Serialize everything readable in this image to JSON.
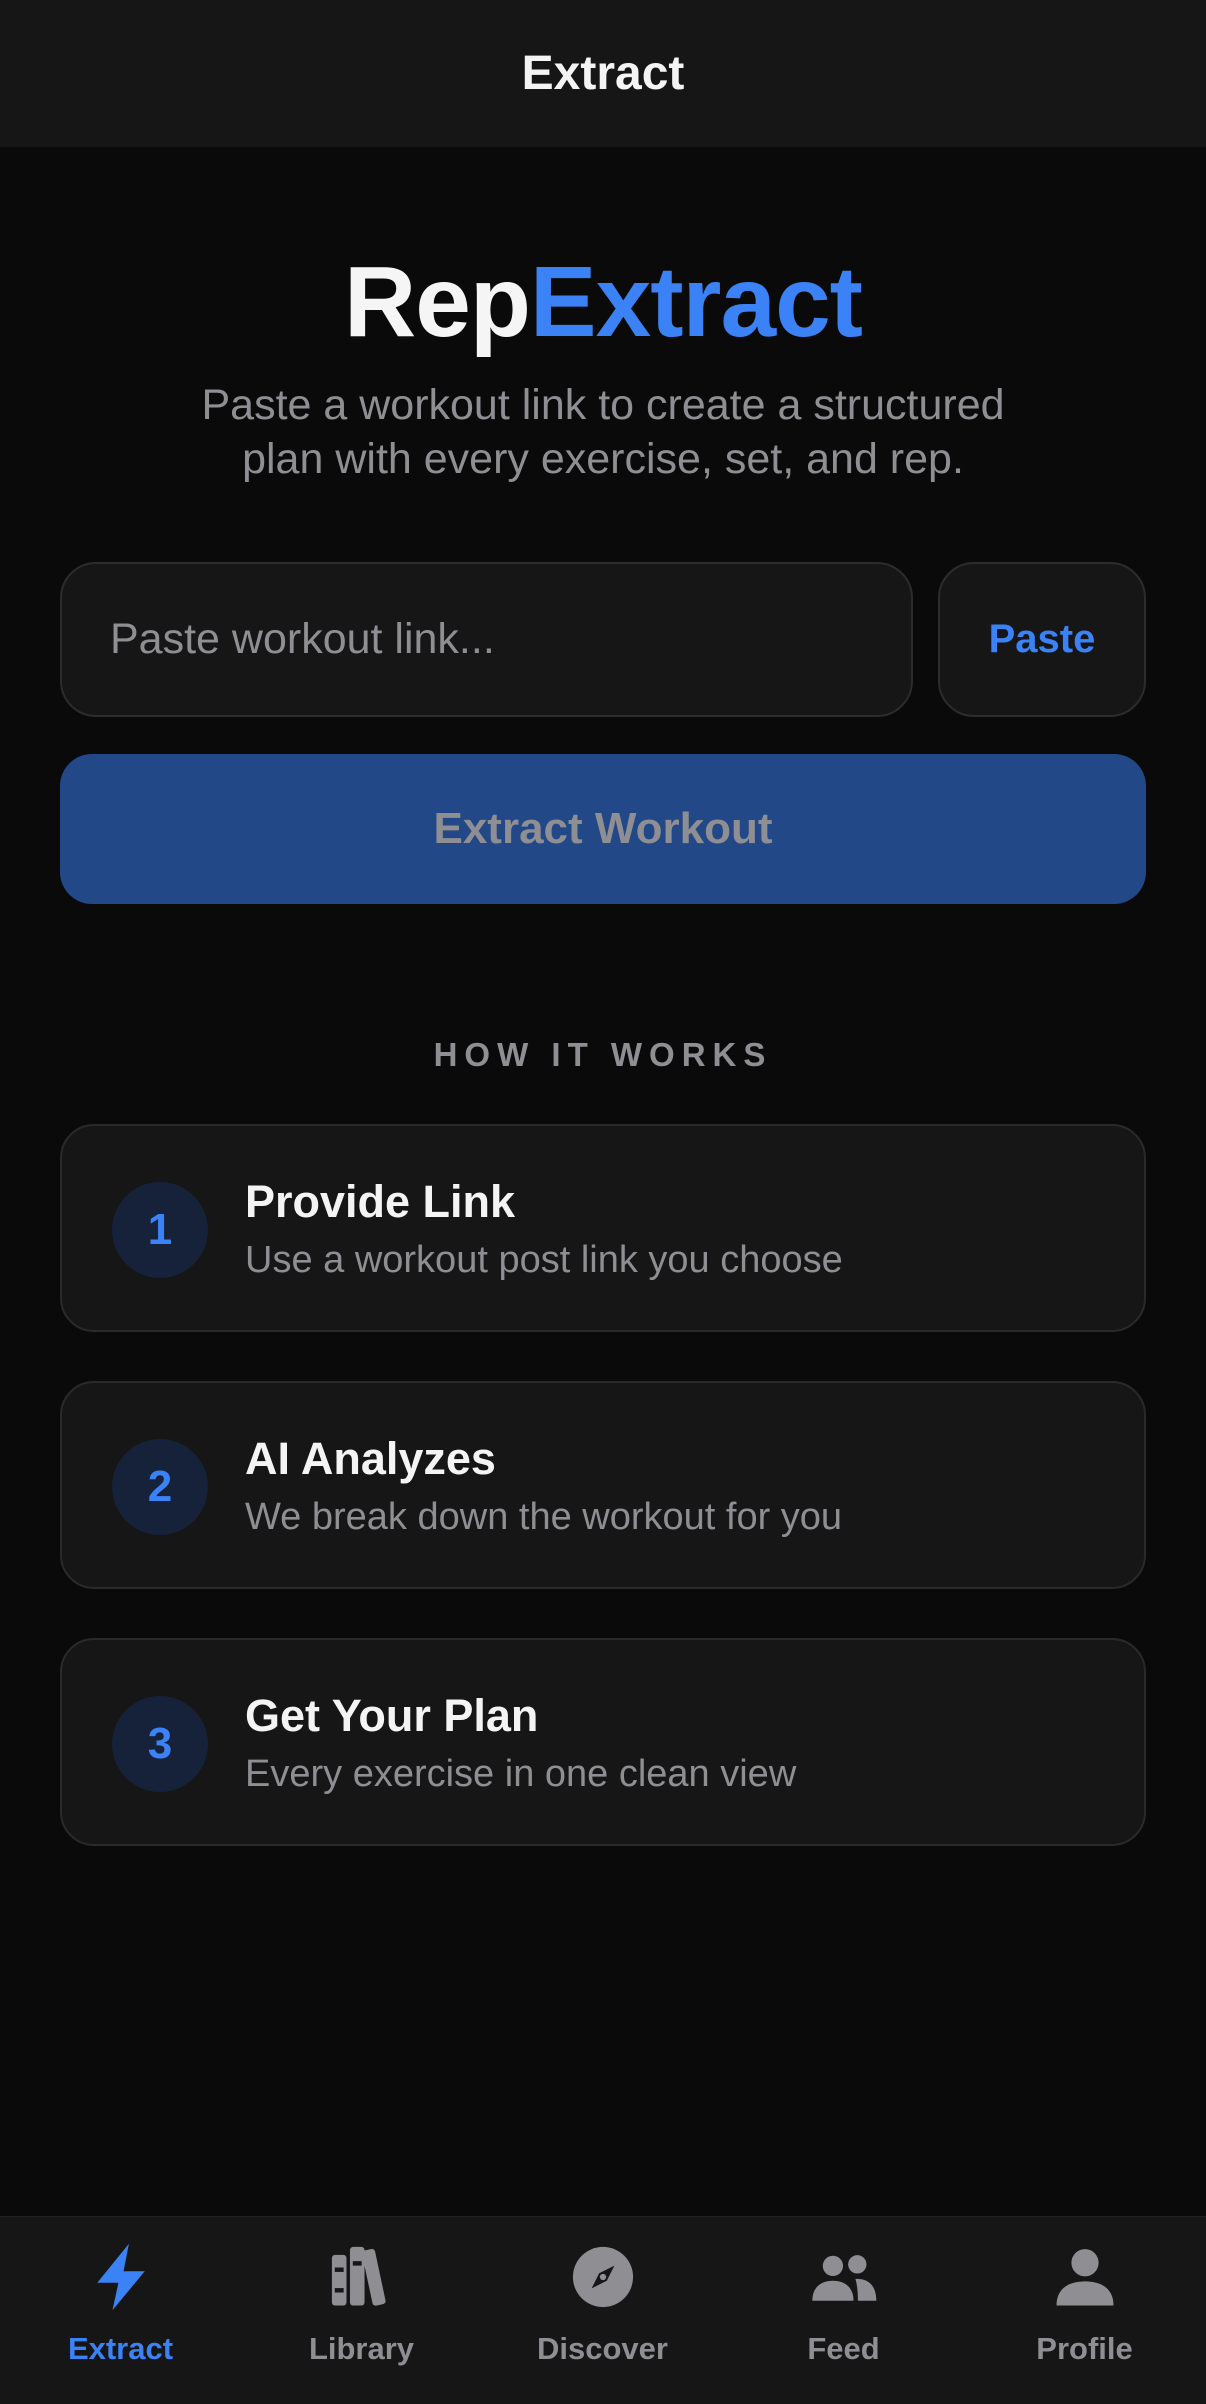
{
  "header": {
    "title": "Extract"
  },
  "brand": {
    "part1": "Rep",
    "part2": "Extract"
  },
  "intro": {
    "line1": "Paste a workout link to create a structured",
    "line2": "plan with every exercise, set, and rep."
  },
  "link_input": {
    "placeholder": "Paste workout link...",
    "value": ""
  },
  "paste_button": {
    "label": "Paste"
  },
  "extract_button": {
    "label": "Extract Workout"
  },
  "how_it_works": {
    "title": "HOW IT WORKS",
    "steps": [
      {
        "number": "1",
        "title": "Provide Link",
        "description": "Use a workout post link you choose"
      },
      {
        "number": "2",
        "title": "AI Analyzes",
        "description": "We break down the workout for you"
      },
      {
        "number": "3",
        "title": "Get Your Plan",
        "description": "Every exercise in one clean view"
      }
    ]
  },
  "tab_bar": {
    "items": [
      {
        "label": "Extract",
        "icon": "bolt-icon",
        "active": true
      },
      {
        "label": "Library",
        "icon": "books-icon",
        "active": false
      },
      {
        "label": "Discover",
        "icon": "compass-icon",
        "active": false
      },
      {
        "label": "Feed",
        "icon": "people-icon",
        "active": false
      },
      {
        "label": "Profile",
        "icon": "person-icon",
        "active": false
      }
    ]
  },
  "colors": {
    "background": "#0a0a0b",
    "surface": "#161617",
    "accent": "#3b82f6",
    "accent_button": "#234888",
    "muted_text": "#8e8e93"
  }
}
